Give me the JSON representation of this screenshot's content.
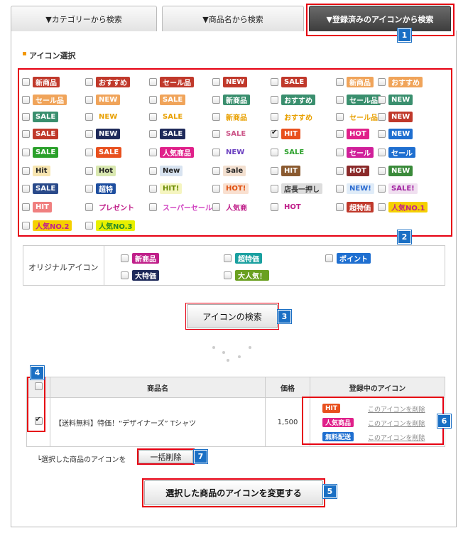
{
  "tabs": [
    {
      "label": "▼カテゴリーから検索"
    },
    {
      "label": "▼商品名から検索"
    },
    {
      "label": "▼登録済みのアイコンから検索"
    }
  ],
  "section_title": "アイコン選択",
  "icons": [
    {
      "label": "新商品",
      "bg": "#c0392b",
      "fg": "#fff"
    },
    {
      "label": "おすすめ",
      "bg": "#c0392b",
      "fg": "#fff"
    },
    {
      "label": "セール品",
      "bg": "#c0392b",
      "fg": "#fff"
    },
    {
      "label": "NEW",
      "bg": "#c0392b",
      "fg": "#fff"
    },
    {
      "label": "SALE",
      "bg": "#c0392b",
      "fg": "#fff"
    },
    {
      "label": "新商品",
      "bg": "#f0a45a",
      "fg": "#fff"
    },
    {
      "label": "おすすめ",
      "bg": "#f0a45a",
      "fg": "#fff"
    },
    {
      "label": "セール品",
      "bg": "#f0a45a",
      "fg": "#fff"
    },
    {
      "label": "NEW",
      "bg": "#f0a45a",
      "fg": "#fff"
    },
    {
      "label": "SALE",
      "bg": "#f0a45a",
      "fg": "#fff"
    },
    {
      "label": "新商品",
      "bg": "#3a8f6e",
      "fg": "#fff"
    },
    {
      "label": "おすすめ",
      "bg": "#3a8f6e",
      "fg": "#fff"
    },
    {
      "label": "セール品",
      "bg": "#3a8f6e",
      "fg": "#fff"
    },
    {
      "label": "NEW",
      "bg": "#3a8f6e",
      "fg": "#fff"
    },
    {
      "label": "SALE",
      "bg": "#3a8f6e",
      "fg": "#fff"
    },
    {
      "label": "NEW",
      "bg": "transparent",
      "fg": "#e8a000"
    },
    {
      "label": "SALE",
      "bg": "transparent",
      "fg": "#e8a000"
    },
    {
      "label": "新商品",
      "bg": "transparent",
      "fg": "#e8a000"
    },
    {
      "label": "おすすめ",
      "bg": "transparent",
      "fg": "#e8a000"
    },
    {
      "label": "セール品",
      "bg": "transparent",
      "fg": "#e8a000"
    },
    {
      "label": "NEW",
      "bg": "#c0392b",
      "fg": "#fff"
    },
    {
      "label": "SALE",
      "bg": "#c0392b",
      "fg": "#fff"
    },
    {
      "label": "NEW",
      "bg": "#1e2a5a",
      "fg": "#fff"
    },
    {
      "label": "SALE",
      "bg": "#1e2a5a",
      "fg": "#fff"
    },
    {
      "label": "SALE",
      "bg": "transparent",
      "fg": "#c58"
    },
    {
      "label": "HIT",
      "bg": "#e8501e",
      "fg": "#fff"
    },
    {
      "label": "HOT",
      "bg": "#e0208a",
      "fg": "#fff"
    },
    {
      "label": "NEW",
      "bg": "#1f6fd0",
      "fg": "#fff"
    },
    {
      "label": "SALE",
      "bg": "#2aa02a",
      "fg": "#fff"
    },
    {
      "label": "SALE",
      "bg": "#e8501e",
      "fg": "#fff"
    },
    {
      "label": "人気商品",
      "bg": "#e0208a",
      "fg": "#fff"
    },
    {
      "label": "NEW",
      "bg": "transparent",
      "fg": "#6a3fc0"
    },
    {
      "label": "SALE",
      "bg": "transparent",
      "fg": "#2aa02a"
    },
    {
      "label": "セール",
      "bg": "#d0209a",
      "fg": "#fff"
    },
    {
      "label": "セール",
      "bg": "#1f6fd0",
      "fg": "#fff"
    },
    {
      "label": "Hit",
      "bg": "#f7e5b0",
      "fg": "#222"
    },
    {
      "label": "Hot",
      "bg": "#d9e8b0",
      "fg": "#222"
    },
    {
      "label": "New",
      "bg": "#d8e3f0",
      "fg": "#222"
    },
    {
      "label": "Sale",
      "bg": "#f3e0d0",
      "fg": "#222"
    },
    {
      "label": "HIT",
      "bg": "#8a5a30",
      "fg": "#fff"
    },
    {
      "label": "HOT",
      "bg": "#8a2a2a",
      "fg": "#fff"
    },
    {
      "label": "NEW",
      "bg": "#3a8a3a",
      "fg": "#fff"
    },
    {
      "label": "SALE",
      "bg": "#2a4a8a",
      "fg": "#fff"
    },
    {
      "label": "超特",
      "bg": "#1f4fa0",
      "fg": "#fff"
    },
    {
      "label": "HIT!",
      "bg": "#f5f5c0",
      "fg": "#6a8a00"
    },
    {
      "label": "HOT!",
      "bg": "#f9e0d0",
      "fg": "#e05010"
    },
    {
      "label": "店長一押し",
      "bg": "#ddd",
      "fg": "#333"
    },
    {
      "label": "NEW!",
      "bg": "#e0ecf8",
      "fg": "#2a6ad0"
    },
    {
      "label": "SALE!",
      "bg": "#f0e0f0",
      "fg": "#a020a0"
    },
    {
      "label": "HIT",
      "bg": "#f08080",
      "fg": "#fff"
    },
    {
      "label": "プレゼント",
      "bg": "transparent",
      "fg": "#c0208a"
    },
    {
      "label": "スーパーセール",
      "bg": "transparent",
      "fg": "#d040c0"
    },
    {
      "label": "人気商",
      "bg": "transparent",
      "fg": "#c0208a"
    },
    {
      "label": "HOT",
      "bg": "transparent",
      "fg": "#c0208a"
    },
    {
      "label": "超特価",
      "bg": "#c0392b",
      "fg": "#fff"
    },
    {
      "label": "人気NO.1",
      "bg": "#f5d000",
      "fg": "#c0208a"
    },
    {
      "label": "人気NO.2",
      "bg": "#f5d000",
      "fg": "#c0208a"
    },
    {
      "label": "人気NO.3",
      "bg": "#e8f000",
      "fg": "#2a8a2a"
    }
  ],
  "original_icons_label": "オリジナルアイコン",
  "original_icons": [
    {
      "label": "新商品",
      "bg": "#c0208a"
    },
    {
      "label": "超特価",
      "bg": "#1aa0a0"
    },
    {
      "label": "ポイント",
      "bg": "#1f6fd0"
    },
    {
      "label": "大特価",
      "bg": "#1e2a5a"
    },
    {
      "label": "大人気！",
      "bg": "#6aa020"
    }
  ],
  "search_button": "アイコンの検索",
  "table": {
    "headers": [
      "商品名",
      "価格",
      "登録中のアイコン"
    ],
    "rows": [
      {
        "name": "【送料無料】特価！“デザイナーズ” Tシャツ",
        "price": "1,500",
        "icons": [
          {
            "label": "HIT",
            "bg": "#e8501e",
            "link": "このアイコンを削除"
          },
          {
            "label": "人気商品",
            "bg": "#e0208a",
            "link": "このアイコンを削除"
          },
          {
            "label": "無料配送",
            "bg": "#1f6fd0",
            "link": "このアイコンを削除"
          }
        ]
      }
    ]
  },
  "bulk_delete_label": "└選択した商品のアイコンを",
  "bulk_delete_button": "一括削除",
  "change_button": "選択した商品のアイコンを変更する",
  "callouts": [
    "1",
    "2",
    "3",
    "4",
    "5",
    "6",
    "7"
  ]
}
